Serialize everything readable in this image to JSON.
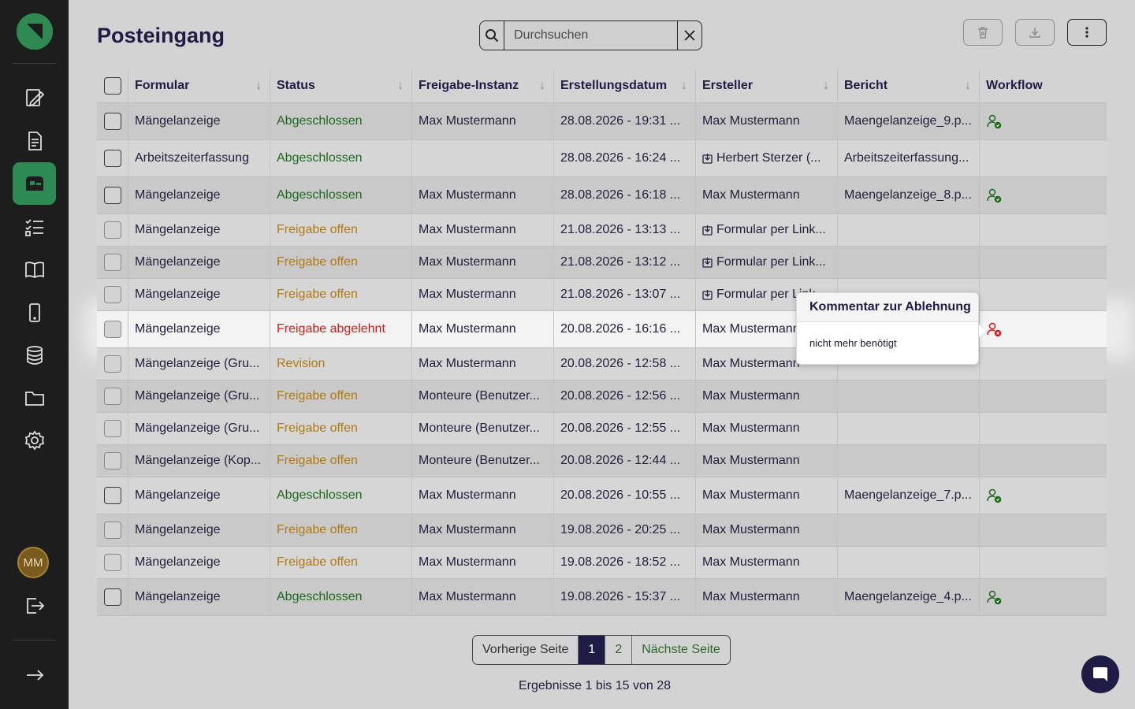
{
  "sidebar": {
    "nav": [
      {
        "icon": "form-edit-icon",
        "active": false
      },
      {
        "icon": "document-icon",
        "active": false
      },
      {
        "icon": "inbox-icon",
        "active": true
      },
      {
        "icon": "checklist-icon",
        "active": false
      },
      {
        "icon": "book-icon",
        "active": false
      },
      {
        "icon": "mobile-icon",
        "active": false
      },
      {
        "icon": "database-icon",
        "active": false
      },
      {
        "icon": "folder-icon",
        "active": false
      },
      {
        "icon": "gear-icon",
        "active": false
      }
    ],
    "avatar_initials": "MM"
  },
  "header": {
    "title": "Posteingang",
    "search_placeholder": "Durchsuchen"
  },
  "columns": [
    "Formular",
    "Status",
    "Freigabe-Instanz",
    "Erstellungsdatum",
    "Ersteller",
    "Bericht",
    "Workflow"
  ],
  "rows": [
    {
      "form": "Mängelanzeige",
      "status": "Abgeschlossen",
      "status_color": "green",
      "instance": "Max Mustermann",
      "date": "28.08.2026 - 19:31 ...",
      "creator": "Max Mustermann",
      "creator_link": false,
      "report": "Maengelanzeige_9.p...",
      "workflow": "approved"
    },
    {
      "form": "Arbeitszeiterfassung",
      "status": "Abgeschlossen",
      "status_color": "green",
      "instance": "",
      "date": "28.08.2026 - 16:24 ...",
      "creator": "Herbert Sterzer (...",
      "creator_link": true,
      "report": "Arbeitszeiterfassung...",
      "workflow": ""
    },
    {
      "form": "Mängelanzeige",
      "status": "Abgeschlossen",
      "status_color": "green",
      "instance": "Max Mustermann",
      "date": "28.08.2026 - 16:18 ...",
      "creator": "Max Mustermann",
      "creator_link": false,
      "report": "Maengelanzeige_8.p...",
      "workflow": "approved"
    },
    {
      "form": "Mängelanzeige",
      "status": "Freigabe offen",
      "status_color": "orange",
      "instance": "Max Mustermann",
      "date": "21.08.2026 - 13:13 ...",
      "creator": "Formular per Link...",
      "creator_link": true,
      "report": "",
      "workflow": ""
    },
    {
      "form": "Mängelanzeige",
      "status": "Freigabe offen",
      "status_color": "orange",
      "instance": "Max Mustermann",
      "date": "21.08.2026 - 13:12 ...",
      "creator": "Formular per Link...",
      "creator_link": true,
      "report": "",
      "workflow": ""
    },
    {
      "form": "Mängelanzeige",
      "status": "Freigabe offen",
      "status_color": "orange",
      "instance": "Max Mustermann",
      "date": "21.08.2026 - 13:07 ...",
      "creator": "Formular per Link...",
      "creator_link": true,
      "report": "",
      "workflow": ""
    },
    {
      "form": "Mängelanzeige",
      "status": "Freigabe abgelehnt",
      "status_color": "red",
      "instance": "Max Mustermann",
      "date": "20.08.2026 - 16:16 ...",
      "creator": "Max Mustermann",
      "creator_link": false,
      "report": "",
      "workflow": "rejected"
    },
    {
      "form": "Mängelanzeige (Gru...",
      "status": "Revision",
      "status_color": "orange",
      "instance": "Max Mustermann",
      "date": "20.08.2026 - 12:58 ...",
      "creator": "Max Mustermann",
      "creator_link": false,
      "report": "",
      "workflow": ""
    },
    {
      "form": "Mängelanzeige (Gru...",
      "status": "Freigabe offen",
      "status_color": "orange",
      "instance": "Monteure (Benutzer...",
      "date": "20.08.2026 - 12:56 ...",
      "creator": "Max Mustermann",
      "creator_link": false,
      "report": "",
      "workflow": ""
    },
    {
      "form": "Mängelanzeige (Gru...",
      "status": "Freigabe offen",
      "status_color": "orange",
      "instance": "Monteure (Benutzer...",
      "date": "20.08.2026 - 12:55 ...",
      "creator": "Max Mustermann",
      "creator_link": false,
      "report": "",
      "workflow": ""
    },
    {
      "form": "Mängelanzeige (Kop...",
      "status": "Freigabe offen",
      "status_color": "orange",
      "instance": "Monteure (Benutzer...",
      "date": "20.08.2026 - 12:44 ...",
      "creator": "Max Mustermann",
      "creator_link": false,
      "report": "",
      "workflow": ""
    },
    {
      "form": "Mängelanzeige",
      "status": "Abgeschlossen",
      "status_color": "green",
      "instance": "Max Mustermann",
      "date": "20.08.2026 - 10:55 ...",
      "creator": "Max Mustermann",
      "creator_link": false,
      "report": "Maengelanzeige_7.p...",
      "workflow": "approved"
    },
    {
      "form": "Mängelanzeige",
      "status": "Freigabe offen",
      "status_color": "orange",
      "instance": "Max Mustermann",
      "date": "19.08.2026 - 20:25 ...",
      "creator": "Max Mustermann",
      "creator_link": false,
      "report": "",
      "workflow": ""
    },
    {
      "form": "Mängelanzeige",
      "status": "Freigabe offen",
      "status_color": "orange",
      "instance": "Max Mustermann",
      "date": "19.08.2026 - 18:52 ...",
      "creator": "Max Mustermann",
      "creator_link": false,
      "report": "",
      "workflow": ""
    },
    {
      "form": "Mängelanzeige",
      "status": "Abgeschlossen",
      "status_color": "green",
      "instance": "Max Mustermann",
      "date": "19.08.2026 - 15:37 ...",
      "creator": "Max Mustermann",
      "creator_link": false,
      "report": "Maengelanzeige_4.p...",
      "workflow": "approved"
    }
  ],
  "popover": {
    "title": "Kommentar zur Ablehnung",
    "body": "nicht mehr benötigt"
  },
  "pagination": {
    "prev": "Vorherige Seite",
    "pages": [
      "1",
      "2"
    ],
    "current": "1",
    "next": "Nächste Seite",
    "summary": "Ergebnisse 1 bis 15 von 28"
  },
  "colors": {
    "green": "#1d6a1d",
    "orange": "#b07a12",
    "red": "#d21b1b",
    "accent": "#2c8a52",
    "navy": "#1f1b44"
  }
}
